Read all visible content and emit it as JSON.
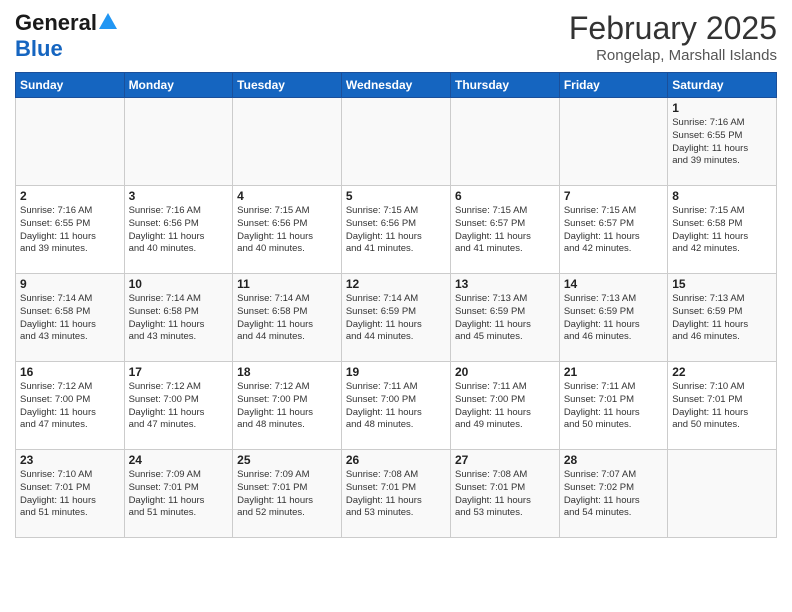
{
  "header": {
    "logo_line1": "General",
    "logo_line2": "Blue",
    "month": "February 2025",
    "location": "Rongelap, Marshall Islands"
  },
  "weekdays": [
    "Sunday",
    "Monday",
    "Tuesday",
    "Wednesday",
    "Thursday",
    "Friday",
    "Saturday"
  ],
  "weeks": [
    [
      {
        "day": "",
        "info": ""
      },
      {
        "day": "",
        "info": ""
      },
      {
        "day": "",
        "info": ""
      },
      {
        "day": "",
        "info": ""
      },
      {
        "day": "",
        "info": ""
      },
      {
        "day": "",
        "info": ""
      },
      {
        "day": "1",
        "info": "Sunrise: 7:16 AM\nSunset: 6:55 PM\nDaylight: 11 hours\nand 39 minutes."
      }
    ],
    [
      {
        "day": "2",
        "info": "Sunrise: 7:16 AM\nSunset: 6:55 PM\nDaylight: 11 hours\nand 39 minutes."
      },
      {
        "day": "3",
        "info": "Sunrise: 7:16 AM\nSunset: 6:56 PM\nDaylight: 11 hours\nand 40 minutes."
      },
      {
        "day": "4",
        "info": "Sunrise: 7:15 AM\nSunset: 6:56 PM\nDaylight: 11 hours\nand 40 minutes."
      },
      {
        "day": "5",
        "info": "Sunrise: 7:15 AM\nSunset: 6:56 PM\nDaylight: 11 hours\nand 41 minutes."
      },
      {
        "day": "6",
        "info": "Sunrise: 7:15 AM\nSunset: 6:57 PM\nDaylight: 11 hours\nand 41 minutes."
      },
      {
        "day": "7",
        "info": "Sunrise: 7:15 AM\nSunset: 6:57 PM\nDaylight: 11 hours\nand 42 minutes."
      },
      {
        "day": "8",
        "info": "Sunrise: 7:15 AM\nSunset: 6:58 PM\nDaylight: 11 hours\nand 42 minutes."
      }
    ],
    [
      {
        "day": "9",
        "info": "Sunrise: 7:14 AM\nSunset: 6:58 PM\nDaylight: 11 hours\nand 43 minutes."
      },
      {
        "day": "10",
        "info": "Sunrise: 7:14 AM\nSunset: 6:58 PM\nDaylight: 11 hours\nand 43 minutes."
      },
      {
        "day": "11",
        "info": "Sunrise: 7:14 AM\nSunset: 6:58 PM\nDaylight: 11 hours\nand 44 minutes."
      },
      {
        "day": "12",
        "info": "Sunrise: 7:14 AM\nSunset: 6:59 PM\nDaylight: 11 hours\nand 44 minutes."
      },
      {
        "day": "13",
        "info": "Sunrise: 7:13 AM\nSunset: 6:59 PM\nDaylight: 11 hours\nand 45 minutes."
      },
      {
        "day": "14",
        "info": "Sunrise: 7:13 AM\nSunset: 6:59 PM\nDaylight: 11 hours\nand 46 minutes."
      },
      {
        "day": "15",
        "info": "Sunrise: 7:13 AM\nSunset: 6:59 PM\nDaylight: 11 hours\nand 46 minutes."
      }
    ],
    [
      {
        "day": "16",
        "info": "Sunrise: 7:12 AM\nSunset: 7:00 PM\nDaylight: 11 hours\nand 47 minutes."
      },
      {
        "day": "17",
        "info": "Sunrise: 7:12 AM\nSunset: 7:00 PM\nDaylight: 11 hours\nand 47 minutes."
      },
      {
        "day": "18",
        "info": "Sunrise: 7:12 AM\nSunset: 7:00 PM\nDaylight: 11 hours\nand 48 minutes."
      },
      {
        "day": "19",
        "info": "Sunrise: 7:11 AM\nSunset: 7:00 PM\nDaylight: 11 hours\nand 48 minutes."
      },
      {
        "day": "20",
        "info": "Sunrise: 7:11 AM\nSunset: 7:00 PM\nDaylight: 11 hours\nand 49 minutes."
      },
      {
        "day": "21",
        "info": "Sunrise: 7:11 AM\nSunset: 7:01 PM\nDaylight: 11 hours\nand 50 minutes."
      },
      {
        "day": "22",
        "info": "Sunrise: 7:10 AM\nSunset: 7:01 PM\nDaylight: 11 hours\nand 50 minutes."
      }
    ],
    [
      {
        "day": "23",
        "info": "Sunrise: 7:10 AM\nSunset: 7:01 PM\nDaylight: 11 hours\nand 51 minutes."
      },
      {
        "day": "24",
        "info": "Sunrise: 7:09 AM\nSunset: 7:01 PM\nDaylight: 11 hours\nand 51 minutes."
      },
      {
        "day": "25",
        "info": "Sunrise: 7:09 AM\nSunset: 7:01 PM\nDaylight: 11 hours\nand 52 minutes."
      },
      {
        "day": "26",
        "info": "Sunrise: 7:08 AM\nSunset: 7:01 PM\nDaylight: 11 hours\nand 53 minutes."
      },
      {
        "day": "27",
        "info": "Sunrise: 7:08 AM\nSunset: 7:01 PM\nDaylight: 11 hours\nand 53 minutes."
      },
      {
        "day": "28",
        "info": "Sunrise: 7:07 AM\nSunset: 7:02 PM\nDaylight: 11 hours\nand 54 minutes."
      },
      {
        "day": "",
        "info": ""
      }
    ]
  ]
}
